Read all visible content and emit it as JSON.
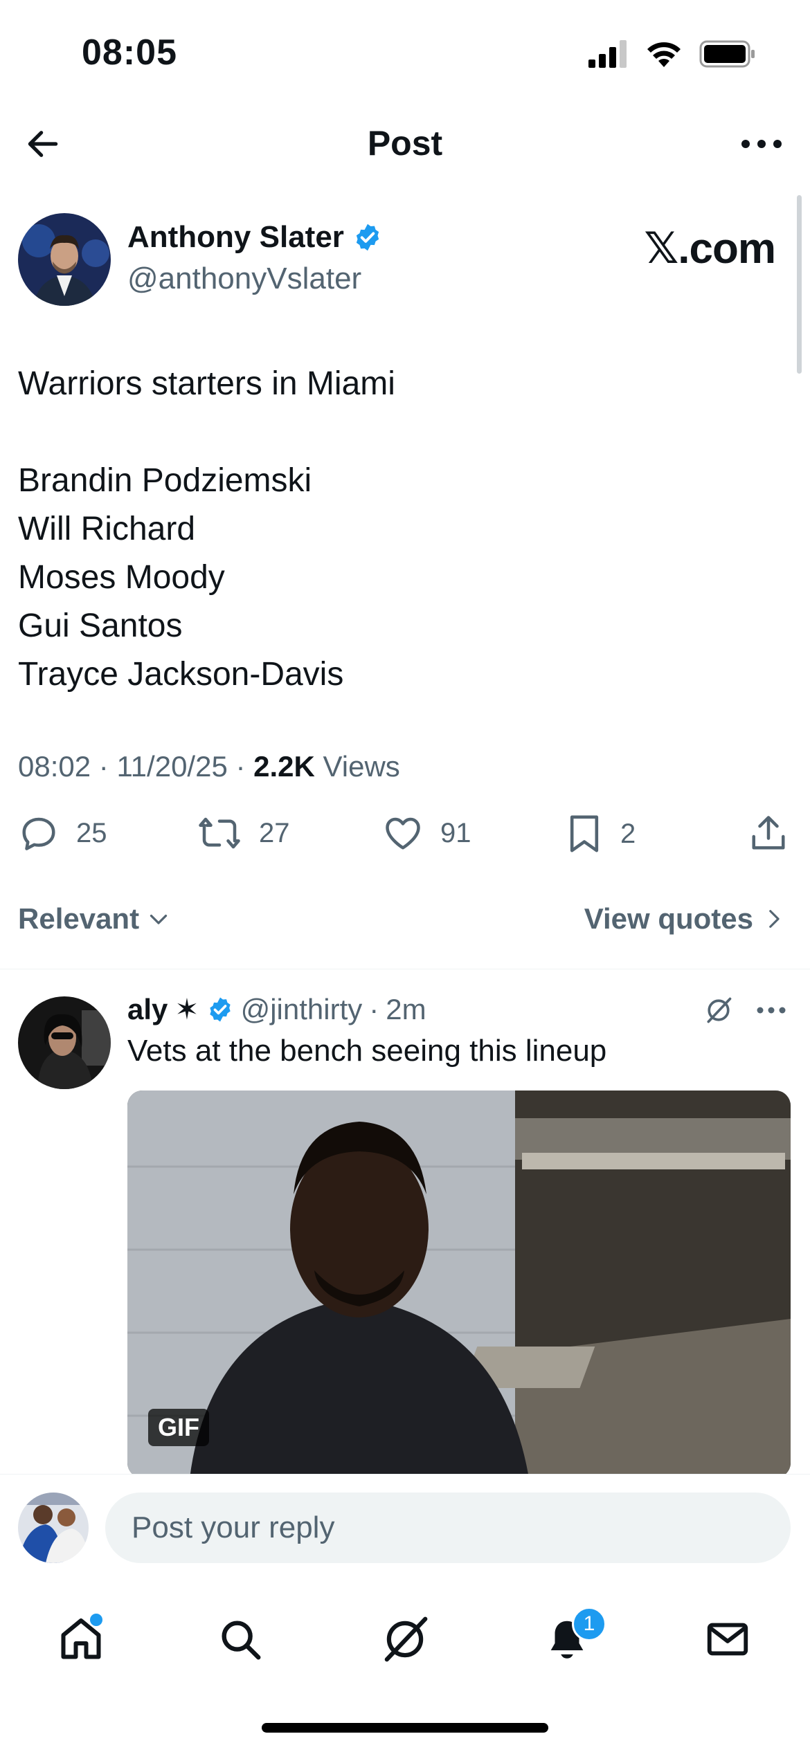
{
  "status_bar": {
    "time": "08:05"
  },
  "header": {
    "title": "Post"
  },
  "post": {
    "author_name": "Anthony Slater",
    "author_handle": "@anthonyVslater",
    "source_brand": "𝕏.com",
    "text_lines": [
      "Warriors starters in Miami",
      "",
      "Brandin Podziemski",
      "Will Richard",
      "Moses Moody",
      "Gui Santos",
      "Trayce Jackson-Davis"
    ],
    "time": "08:02",
    "date": "11/20/25",
    "views_count": "2.2K",
    "views_label": "Views"
  },
  "actions": {
    "replies": "25",
    "reposts": "27",
    "likes": "91",
    "bookmarks": "2"
  },
  "sort": {
    "label": "Relevant",
    "view_quotes": "View quotes"
  },
  "reply": {
    "name": "aly",
    "name_suffix": "✶",
    "handle": "@jinthirty",
    "separator": "·",
    "time": "2m",
    "text": "Vets at the bench seeing this lineup",
    "media_badge": "GIF"
  },
  "composer": {
    "placeholder": "Post your reply"
  },
  "tabs": {
    "notifications_badge": "1"
  },
  "colors": {
    "accent": "#1d9bf0",
    "secondary_text": "#536471",
    "primary_text": "#0f1419"
  }
}
